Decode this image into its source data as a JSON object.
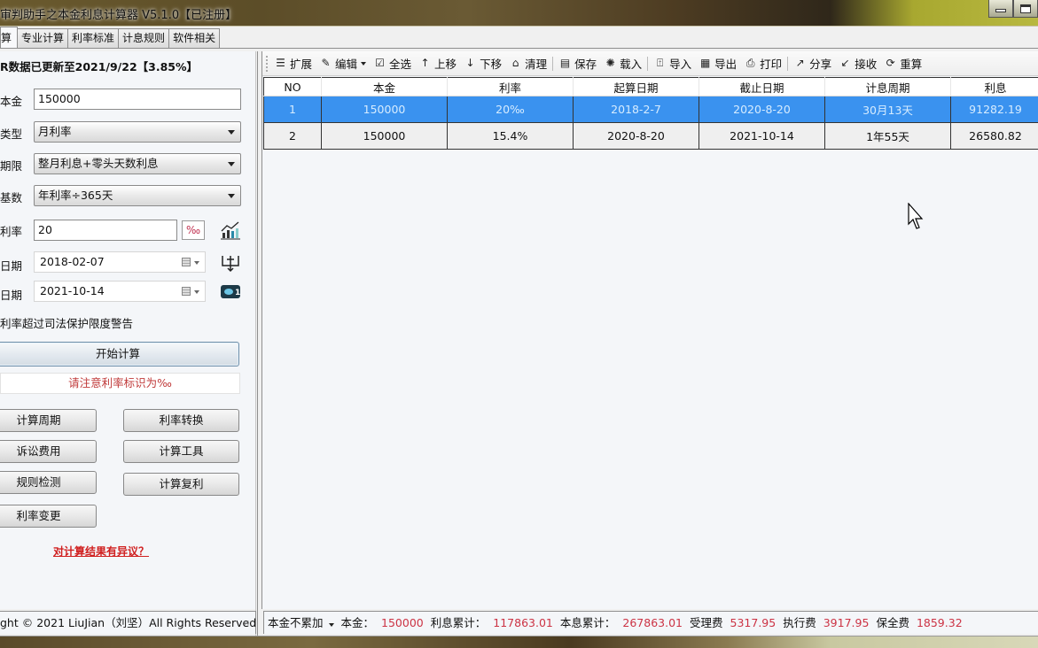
{
  "window": {
    "title": "审判助手之本金利息计算器 V5.1.0【已注册】",
    "minimize_icon": "minimize-icon",
    "maximize_icon": "maximize-icon"
  },
  "tabs": [
    {
      "label": "算",
      "active": true
    },
    {
      "label": "专业计算"
    },
    {
      "label": "利率标准"
    },
    {
      "label": "计息规则"
    },
    {
      "label": "软件相关"
    }
  ],
  "left": {
    "notice": "R数据已更新至2021/9/22【3.85%】",
    "principal": {
      "label": "本金",
      "value": "150000"
    },
    "rate_type": {
      "label": "类型",
      "value": "月利率"
    },
    "term": {
      "label": "期限",
      "value": "整月利息+零头天数利息"
    },
    "base": {
      "label": "基数",
      "value": "年利率÷365天"
    },
    "rate": {
      "label": "利率",
      "value": "20",
      "unit": "‰"
    },
    "start_date": {
      "label": "日期",
      "value": "2018-02-07"
    },
    "end_date": {
      "label": "日期",
      "value": "2021-10-14"
    },
    "warning_checkbox": "利率超过司法保护限度警告",
    "start_button": "开始计算",
    "hint": "请注意利率标识为‰",
    "buttons": [
      {
        "label": "计算周期"
      },
      {
        "label": "利率转换"
      },
      {
        "label": "诉讼费用"
      },
      {
        "label": "计算工具"
      },
      {
        "label": "规则检测"
      },
      {
        "label": "计算复利"
      },
      {
        "label": "利率变更"
      }
    ],
    "dispute_link": "对计算结果有异议？"
  },
  "toolbar": [
    {
      "label": "扩展",
      "icon": "expand-list-icon"
    },
    {
      "label": "编辑",
      "icon": "edit-icon",
      "dropdown": true
    },
    {
      "label": "全选",
      "icon": "select-all-icon"
    },
    {
      "label": "上移",
      "icon": "arrow-up-icon"
    },
    {
      "label": "下移",
      "icon": "arrow-down-icon"
    },
    {
      "label": "清理",
      "icon": "clean-icon"
    },
    {
      "label": "保存",
      "icon": "save-icon"
    },
    {
      "label": "载入",
      "icon": "load-icon"
    },
    {
      "label": "导入",
      "icon": "import-icon"
    },
    {
      "label": "导出",
      "icon": "export-icon"
    },
    {
      "label": "打印",
      "icon": "print-icon"
    },
    {
      "label": "分享",
      "icon": "share-icon"
    },
    {
      "label": "接收",
      "icon": "receive-icon"
    },
    {
      "label": "重算",
      "icon": "recalculate-icon"
    }
  ],
  "table": {
    "columns": [
      "NO",
      "本金",
      "利率",
      "起算日期",
      "截止日期",
      "计息周期",
      "利息"
    ],
    "rows": [
      {
        "cells": [
          "1",
          "150000",
          "20‰",
          "2018-2-7",
          "2020-8-20",
          "30月13天",
          "91282.19"
        ],
        "selected": true
      },
      {
        "cells": [
          "2",
          "150000",
          "15.4%",
          "2020-8-20",
          "2021-10-14",
          "1年55天",
          "26580.82"
        ],
        "selected": false
      }
    ]
  },
  "status_left": "ght © 2021 LiuJian（刘坚）All Rights Reserved",
  "status_right": {
    "mode": "本金不累加",
    "principal_label": "本金：",
    "principal": "150000",
    "interest_total_label": "利息累计：",
    "interest_total": "117863.01",
    "sum_total_label": "本息累计：",
    "sum_total": "267863.01",
    "acceptance_fee_label": "受理费",
    "acceptance_fee": "5317.95",
    "execution_fee_label": "执行费",
    "execution_fee": "3917.95",
    "preservation_fee_label": "保全费",
    "preservation_fee": "1859.32"
  }
}
